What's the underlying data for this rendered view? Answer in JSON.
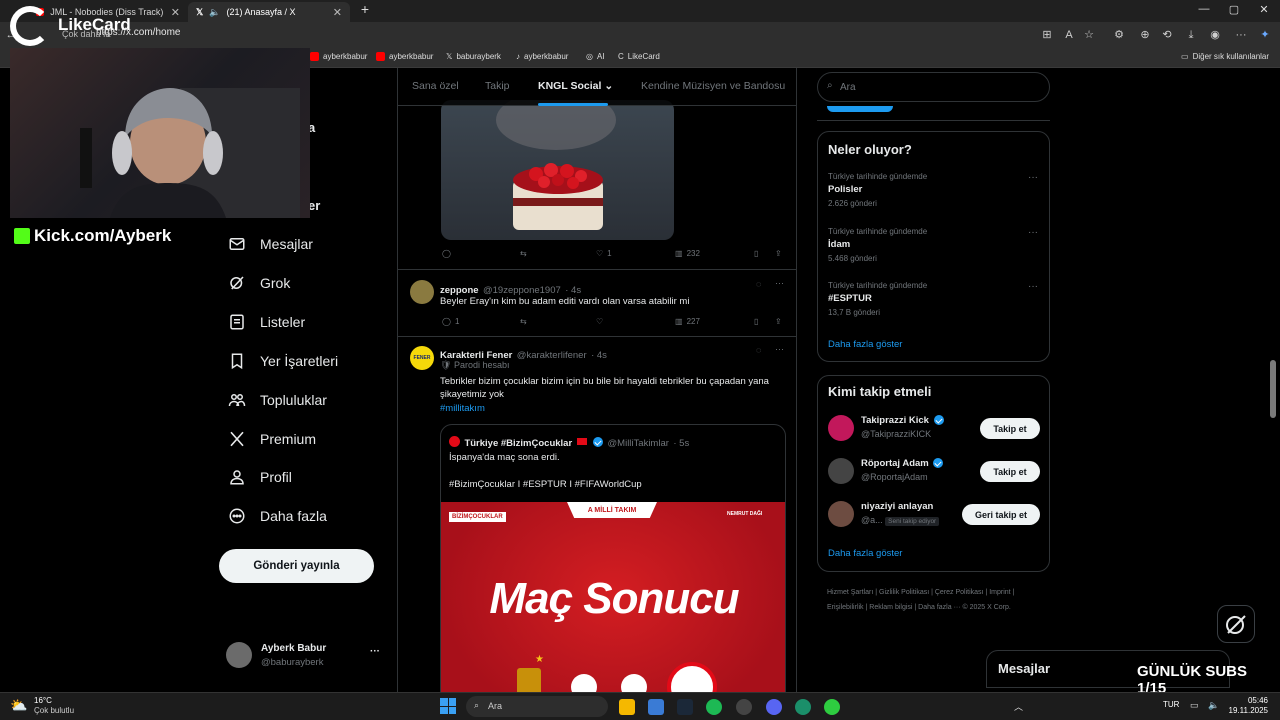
{
  "browser": {
    "tabs": [
      {
        "title": "JML - Nobodies (Diss Track) #DDK",
        "active": false
      },
      {
        "title": "(21) Anasayfa / X",
        "active": true
      }
    ],
    "url": "https://x.com/home",
    "url_overlay_text": "Çok daha fa",
    "bookmarks": [
      "ayberkbabur",
      "ayberkbabur",
      "baburayberk",
      "ayberkbabur",
      "AI",
      "LikeCard"
    ],
    "bookmarks_other": "Diğer sık kullanılanlar"
  },
  "overlay": {
    "likecard": "LikeCard",
    "kick": "Kick.com/Ayberk",
    "subs": "GÜNLÜK SUBS 1/15",
    "webcam_partial_letters": [
      "a",
      "er"
    ]
  },
  "nav": {
    "items": [
      "Mesajlar",
      "Grok",
      "Listeler",
      "Yer İşaretleri",
      "Topluluklar",
      "Premium",
      "Profil",
      "Daha fazla"
    ],
    "post_button": "Gönderi yayınla",
    "account_name": "Ayberk Babur",
    "account_handle": "@baburayberk",
    "account_more": "···"
  },
  "feed": {
    "tabs": [
      "Sana özel",
      "Takip",
      "KNGL Social",
      "Kendine Müzisyen ve Bandosu"
    ],
    "active_tab": "KNGL Social",
    "post1": {
      "likes": "1",
      "views": "232"
    },
    "post2": {
      "name": "zeppone",
      "handle": "@19zeppone1907",
      "time": "· 4s",
      "text": "Beyler Eray'ın kim bu adam editi vardı olan varsa atabilir mi",
      "replies": "1",
      "views": "227"
    },
    "post3": {
      "name": "Karakterli Fener",
      "handle": "@karakterlifener",
      "time": "· 4s",
      "avatar_text": "FENER",
      "parody": "Parodi hesabı",
      "text": "Tebrikler bizim çocuklar bizim için bu bile bir hayaldi tebrikler bu çapadan yana şikayetimiz yok",
      "hashtag": "#millitakım",
      "quote": {
        "name": "Türkiye #BizimÇocuklar",
        "handle": "@MilliTakimlar",
        "time": "· 5s",
        "line1": "İspanya'da maç sona erdi.",
        "line2": "#BizimÇocuklar I #ESPTUR I #FIFAWorldCup",
        "image_tag_left": "BİZİMÇOCUKLAR",
        "image_tag_center": "A MİLLİ TAKIM",
        "image_tag_right": "NEMRUT DAĞI",
        "image_title": "Maç Sonucu"
      }
    }
  },
  "right": {
    "search_placeholder": "Ara",
    "trends_title": "Neler oluyor?",
    "trends": [
      {
        "context": "Türkiye tarihinde gündemde",
        "name": "Polisler",
        "count": "2.626 gönderi"
      },
      {
        "context": "Türkiye tarihinde gündemde",
        "name": "İdam",
        "count": "5.468 gönderi"
      },
      {
        "context": "Türkiye tarihinde gündemde",
        "name": "#ESPTUR",
        "count": "13,7 B gönderi"
      }
    ],
    "show_more": "Daha fazla göster",
    "who_title": "Kimi takip etmeli",
    "who": [
      {
        "name": "Takiprazzi Kick",
        "handle": "@TakiprazziKICK",
        "button": "Takip et",
        "verified": true,
        "avatar_color": "#c2185b"
      },
      {
        "name": "Röportaj Adam",
        "handle": "@RoportajAdam",
        "button": "Takip et",
        "verified": true,
        "avatar_color": "#444"
      },
      {
        "name": "niyaziyi anlayan",
        "handle": "@a...",
        "badge": "Seni takip ediyor",
        "button": "Geri takip et",
        "verified": false,
        "avatar_color": "#6d4c41"
      }
    ],
    "footer": "Hizmet Şartları  |  Gizlilik Politikası  |  Çerez Politikası  |  Imprint  |  Erişilebilirlik  |  Reklam bilgisi  |  Daha fazla ···  © 2025 X Corp.",
    "messages_dock": "Mesajlar"
  },
  "taskbar": {
    "weather_temp": "16°C",
    "weather_desc": "Çok bulutlu",
    "search": "Ara",
    "lang": "TUR",
    "time": "05:46",
    "date": "19.11.2025"
  },
  "colors": {
    "accent": "#1d9bf0",
    "kick": "#53fc18",
    "quote_image": "#c0171c"
  }
}
